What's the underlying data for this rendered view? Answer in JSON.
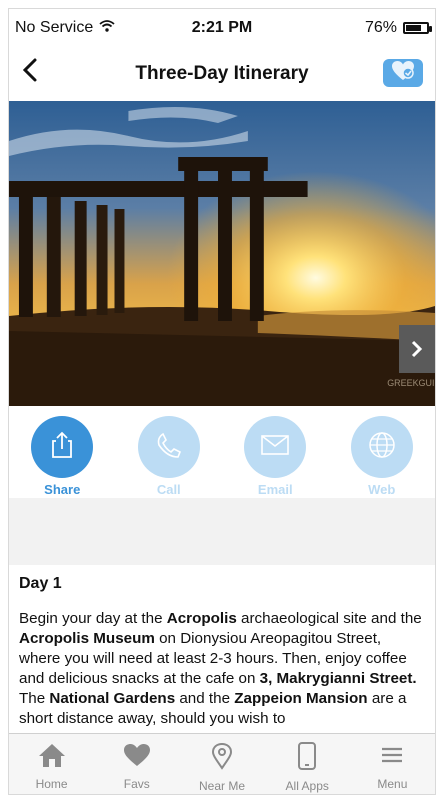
{
  "status_bar": {
    "carrier": "No Service",
    "time": "2:21 PM",
    "battery": "76%",
    "battery_level": 0.76
  },
  "nav": {
    "title": "Three-Day Itinerary"
  },
  "actions": [
    {
      "label": "Share",
      "icon": "share-icon",
      "active": true
    },
    {
      "label": "Call",
      "icon": "phone-icon",
      "active": false
    },
    {
      "label": "Email",
      "icon": "envelope-icon",
      "active": false
    },
    {
      "label": "Web",
      "icon": "globe-icon",
      "active": false
    }
  ],
  "content": {
    "heading": "Day 1",
    "paragraph": [
      {
        "t": "Begin your day at the "
      },
      {
        "t": "Acropolis",
        "b": true
      },
      {
        "t": " archaeological site and the "
      },
      {
        "t": "Acropolis Museum",
        "b": true
      },
      {
        "t": " on Dionysiou Areopagitou Street, where you will need at least 2-3 hours. Then, enjoy coffee and delicious snacks at the cafe on "
      },
      {
        "t": "3, Makrygianni Street.",
        "b": true
      },
      {
        "t": " The "
      },
      {
        "t": "National Gardens",
        "b": true
      },
      {
        "t": " and the "
      },
      {
        "t": "Zappeion Mansion",
        "b": true
      },
      {
        "t": " are a short distance away, should you wish to"
      }
    ]
  },
  "tab_bar": [
    {
      "label": "Home",
      "icon": "home-icon"
    },
    {
      "label": "Favs",
      "icon": "heart-icon"
    },
    {
      "label": "Near Me",
      "icon": "location-pin-icon"
    },
    {
      "label": "All Apps",
      "icon": "phone-device-icon"
    },
    {
      "label": "Menu",
      "icon": "menu-icon"
    }
  ],
  "colors": {
    "accent": "#3a92d8",
    "accent_light": "#bcdcf4"
  }
}
